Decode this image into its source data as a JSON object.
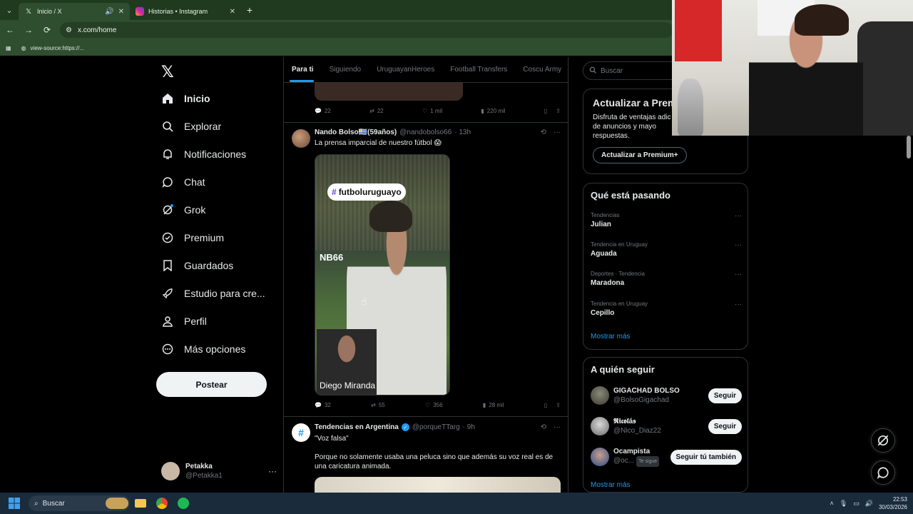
{
  "browser": {
    "tabs": [
      {
        "title": "Inicio / X",
        "active": true
      },
      {
        "title": "Historias • Instagram",
        "active": false
      }
    ],
    "url": "x.com/home",
    "bookmark": "view-source:https://..."
  },
  "nav": {
    "items": [
      {
        "label": "Inicio",
        "icon": "home-icon"
      },
      {
        "label": "Explorar",
        "icon": "search-icon"
      },
      {
        "label": "Notificaciones",
        "icon": "bell-icon"
      },
      {
        "label": "Chat",
        "icon": "chat-icon"
      },
      {
        "label": "Grok",
        "icon": "grok-icon"
      },
      {
        "label": "Premium",
        "icon": "premium-icon"
      },
      {
        "label": "Guardados",
        "icon": "bookmark-icon"
      },
      {
        "label": "Estudio para cre...",
        "icon": "rocket-icon"
      },
      {
        "label": "Perfil",
        "icon": "person-icon"
      },
      {
        "label": "Más opciones",
        "icon": "more-circle-icon"
      }
    ],
    "post_label": "Postear",
    "profile": {
      "name": "Petakka",
      "handle": "@Petakka1"
    }
  },
  "feed": {
    "tabs": [
      "Para ti",
      "Siguiendo",
      "UruguayanHeroes",
      "Football Transfers",
      "Coscu Army"
    ],
    "prev_actions": {
      "replies": "22",
      "reposts": "22",
      "likes": "1 mil",
      "views": "220 mil"
    },
    "tweet1": {
      "name": "Nando Bolso🇺🇾(59años)",
      "handle": "@nandobolso66",
      "time": "· 13h",
      "text": "La prensa imparcial de nuestro fútbol 😱",
      "video_tag": "futboluruguayo",
      "video_overlay": "NB66",
      "video_caption": "Diego Miranda",
      "replies": "32",
      "reposts": "55",
      "likes": "356",
      "views": "28 mil"
    },
    "tweet2": {
      "name": "Tendencias en Argentina",
      "handle": "@porqueTTarg",
      "time": "· 9h",
      "line1": "\"Voz falsa\"",
      "line2": "Porque no solamente usaba una peluca sino que además su voz real es de una caricatura animada."
    }
  },
  "right": {
    "search_placeholder": "Buscar",
    "premium": {
      "title": "Actualizar a Prem",
      "body": "Disfruta de ventajas adic total de anuncios y mayo respuestas.",
      "button": "Actualizar a Premium+"
    },
    "trends": {
      "title": "Qué está pasando",
      "items": [
        {
          "context": "Tendencias",
          "term": "Julian"
        },
        {
          "context": "Tendencia en Uruguay",
          "term": "Aguada"
        },
        {
          "context": "Deportes · Tendencia",
          "term": "Maradona"
        },
        {
          "context": "Tendencia en Uruguay",
          "term": "Cepillo"
        }
      ],
      "show_more": "Mostrar más"
    },
    "follow": {
      "title": "A quién seguir",
      "items": [
        {
          "name": "GIGACHAD BOLSO",
          "handle": "@BolsoGigachad",
          "button": "Seguir",
          "badge": ""
        },
        {
          "name": "𝕽𝖎𝖈𝖔𝖑á𝖘",
          "handle": "@Nico_Diaz22",
          "button": "Seguir",
          "badge": ""
        },
        {
          "name": "Ocampista",
          "handle": "@oc...",
          "button": "Seguir tú también",
          "badge": "Te sigue"
        }
      ],
      "show_more": "Mostrar más"
    }
  },
  "taskbar": {
    "search": "Buscar",
    "time": "22:53",
    "date": "30/03/2026"
  },
  "colors": {
    "accent": "#1d9bf0",
    "chrome": "#2f4d2f",
    "taskbar": "#1a2b3c"
  }
}
